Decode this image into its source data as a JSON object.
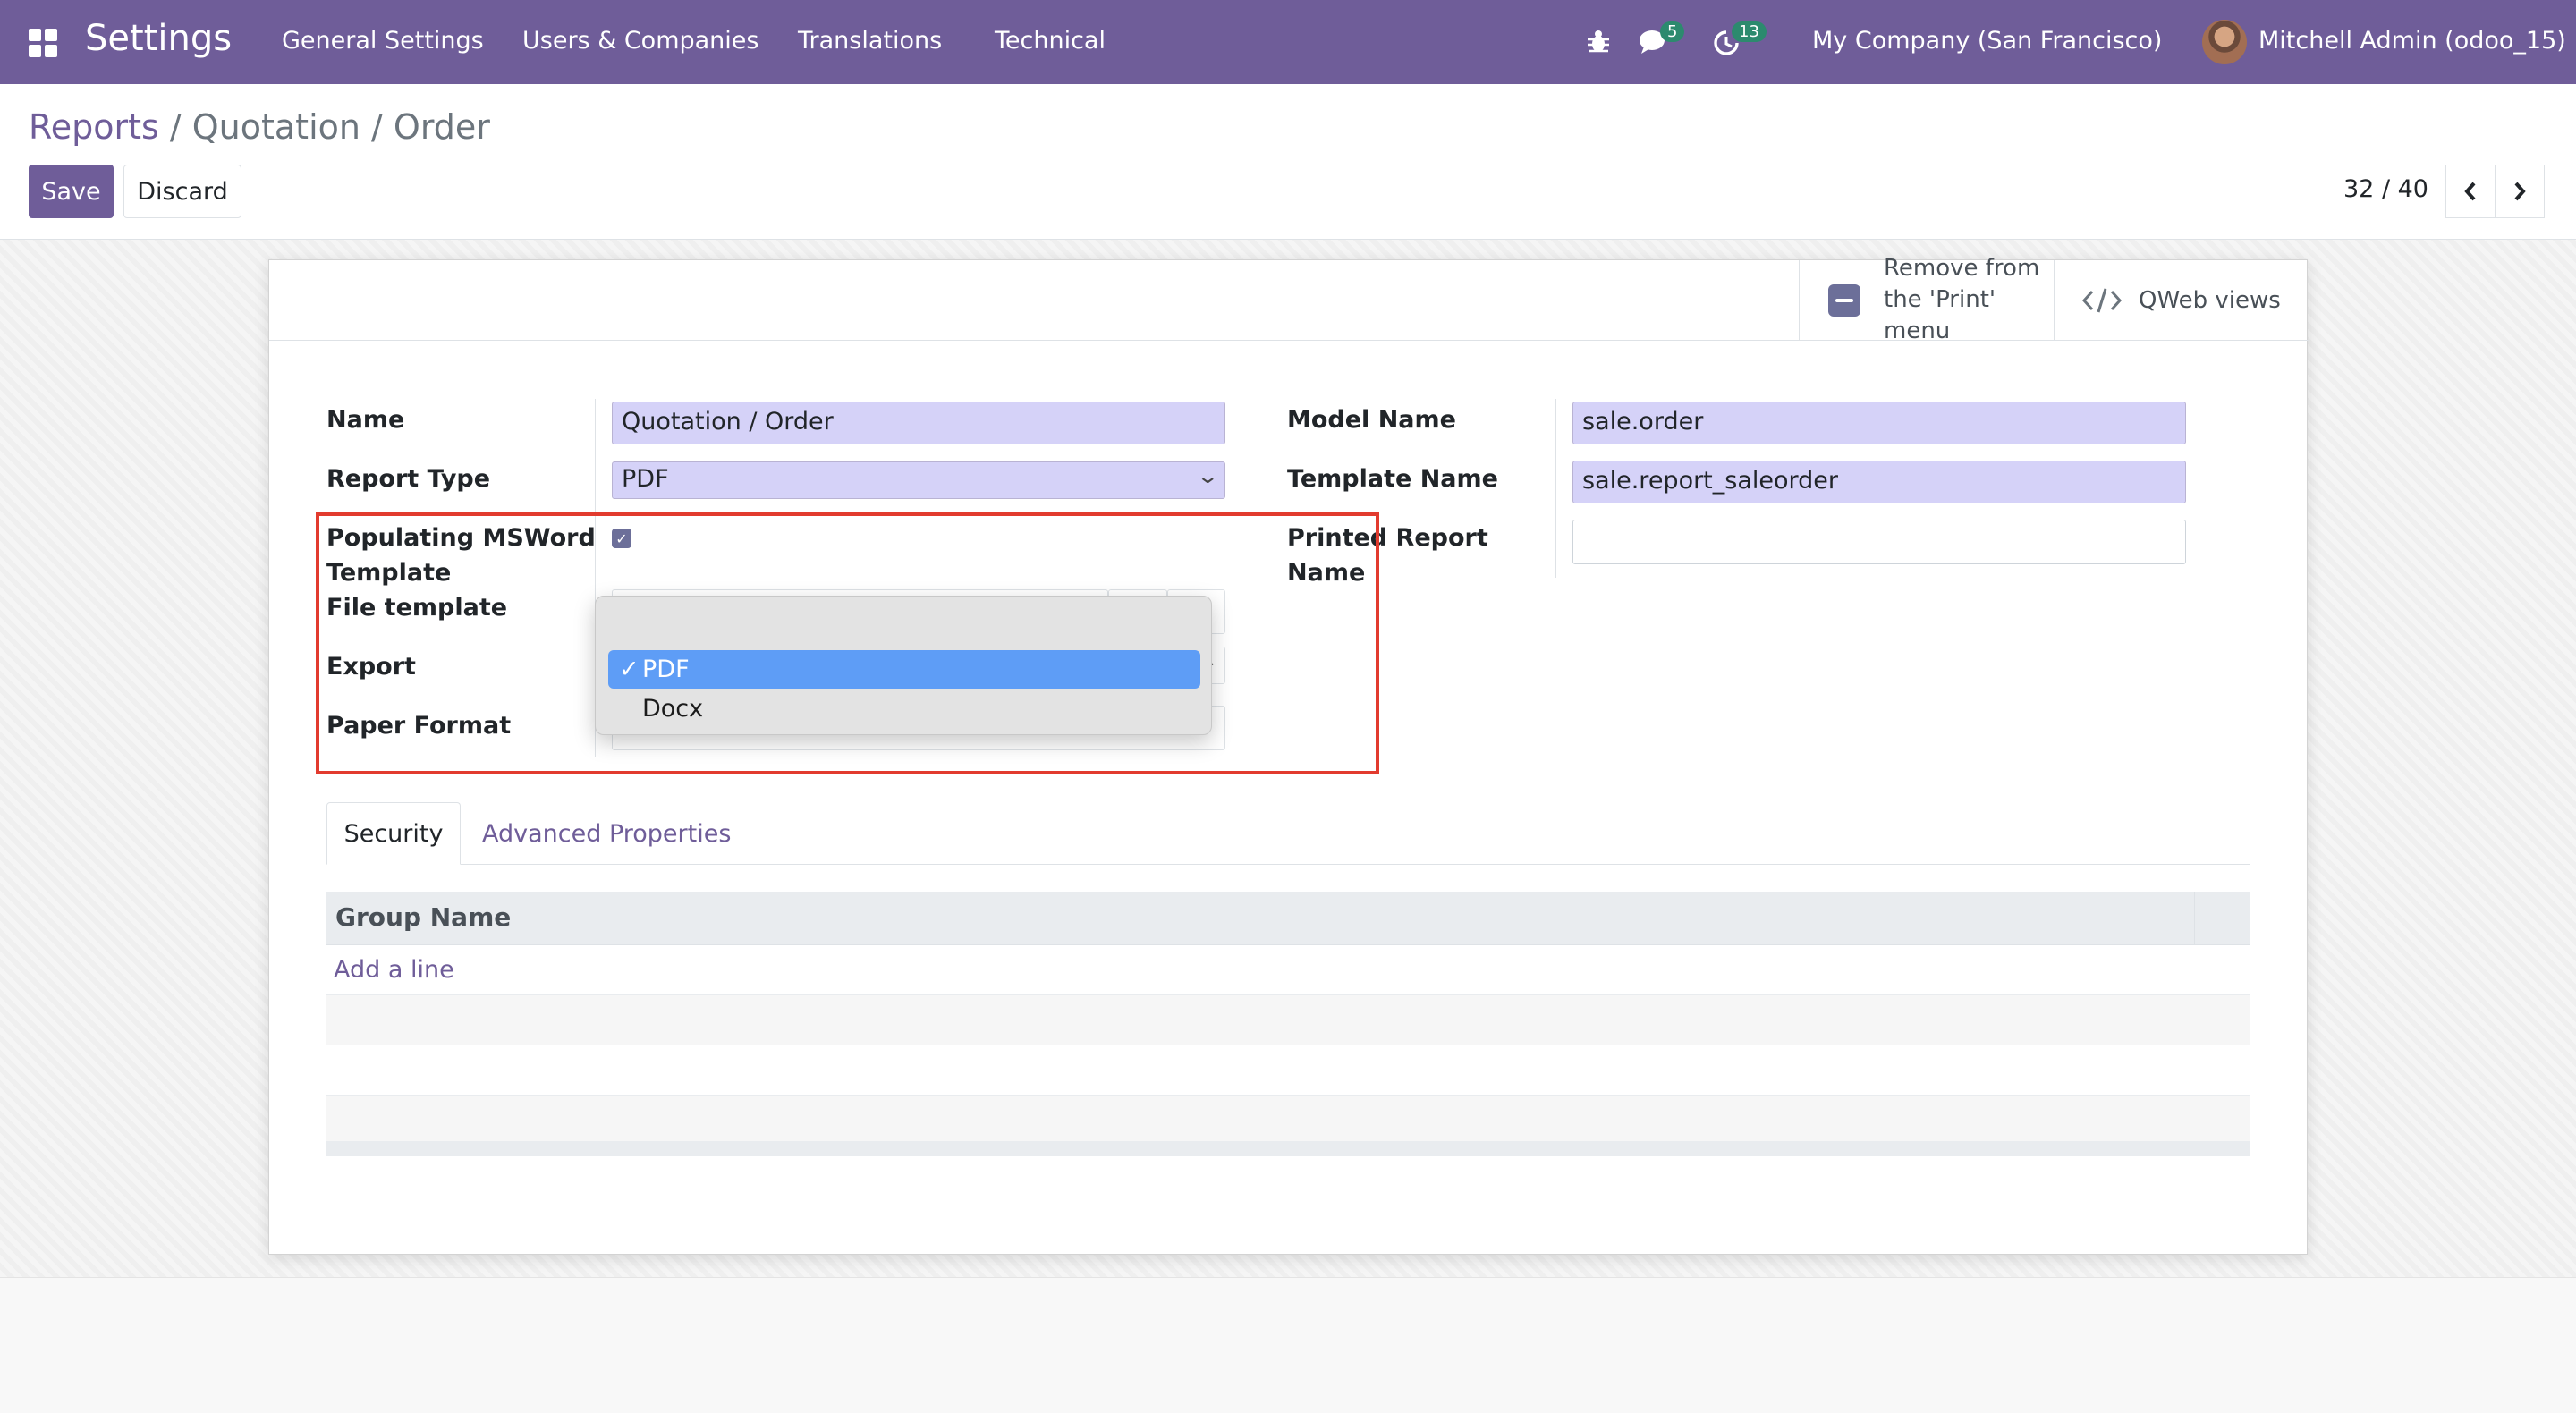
{
  "navbar": {
    "app_title": "Settings",
    "menu": [
      "General Settings",
      "Users & Companies",
      "Translations",
      "Technical"
    ],
    "messages_count": "5",
    "activities_count": "13",
    "company": "My Company (San Francisco)",
    "user": "Mitchell Admin (odoo_15)"
  },
  "breadcrumb": {
    "parent": "Reports",
    "current": "/ Quotation  / Order"
  },
  "actions": {
    "save_label": "Save",
    "discard_label": "Discard"
  },
  "pager": {
    "value": "32 / 40",
    "prev_icon": "chevron-left",
    "next_icon": "chevron-right"
  },
  "button_box": {
    "remove_print_line1": "Remove from",
    "remove_print_line2": "the 'Print'",
    "remove_print_line3": "menu",
    "qweb_views": "QWeb views"
  },
  "form": {
    "name_label": "Name",
    "name_value": "Quotation / Order",
    "report_type_label": "Report Type",
    "report_type_value": "PDF",
    "populating_label_line1": "Populating MSWord",
    "populating_label_line2": "Template",
    "populating_checked": true,
    "file_template_label": "File template",
    "export_label": "Export",
    "paper_format_label": "Paper Format",
    "model_name_label": "Model Name",
    "model_name_value": "sale.order",
    "template_name_label": "Template Name",
    "template_name_value": "sale.report_saleorder",
    "printed_report_name_label_line1": "Printed Report",
    "printed_report_name_label_line2": "Name",
    "printed_report_name_value": ""
  },
  "export_dropdown": {
    "options": [
      "PDF",
      "Docx"
    ],
    "selected": "PDF",
    "check_mark": "✓"
  },
  "tabs": {
    "security": "Security",
    "advanced": "Advanced Properties"
  },
  "table": {
    "column_header": "Group Name",
    "add_line": "Add a line"
  },
  "colors": {
    "navbar": "#6f5d99",
    "highlight_border": "#e23b2e",
    "selected_option": "#5e9df6"
  }
}
